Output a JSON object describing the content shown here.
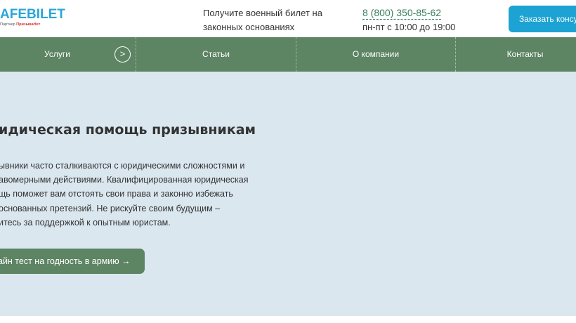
{
  "header": {
    "logo_text": "AFEBILET",
    "logo_partner_prefix": "Партнер",
    "logo_partner_name": "ПризываНет",
    "tagline_line1": "Получите военный билет на",
    "tagline_line2": "законных основаниях",
    "phone": "8 (800) 350-85-62",
    "hours": "пн-пт с 10:00 до 19:00",
    "cta_label": "Заказать консул"
  },
  "nav": {
    "items": [
      {
        "label": "Услуги"
      },
      {
        "label": "Статьи"
      },
      {
        "label": "О компании"
      },
      {
        "label": "Контакты"
      }
    ],
    "arrow_glyph": ">"
  },
  "hero": {
    "title": "идическая помощь призывникам",
    "text_lines": [
      "ывники часто сталкиваются с юридическими сложностями и",
      "авомерными действиями. Квалифицированная юридическая",
      "щь поможет вам отстоять свои права и законно избежать",
      "основанных претензий. Не рискуйте своим будущим –",
      "итесь за поддержкой к опытным юристам."
    ],
    "button_label": "айн тест на годность в армию →"
  },
  "colors": {
    "brand_blue": "#1ca3d3",
    "nav_green": "#5d8463",
    "hero_bg": "#dbe7ef",
    "phone_green": "#3a7d5c"
  }
}
